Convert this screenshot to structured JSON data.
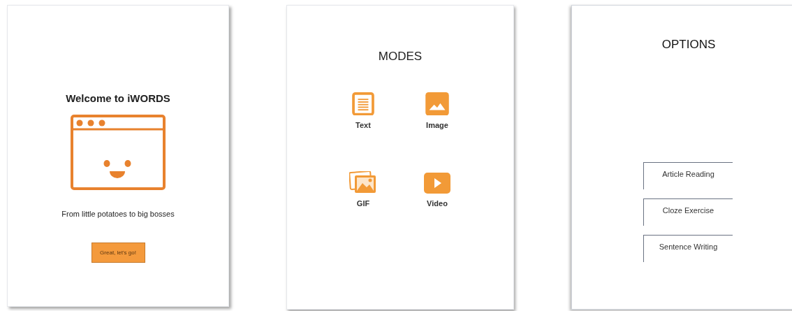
{
  "welcome_screen": {
    "title": "Welcome to iWORDS",
    "tagline": "From little potatoes to big bosses",
    "button": "Great, let's go!"
  },
  "modes_screen": {
    "title": "MODES",
    "modes": [
      {
        "kind": "text",
        "label": "Text"
      },
      {
        "kind": "image",
        "label": "Image"
      },
      {
        "kind": "gif",
        "label": "GIF"
      },
      {
        "kind": "video",
        "label": "Video"
      }
    ]
  },
  "options_screen": {
    "title": "OPTIONS",
    "options": [
      "Article Reading",
      "Cloze Exercise",
      "Sentence Writing"
    ]
  }
}
